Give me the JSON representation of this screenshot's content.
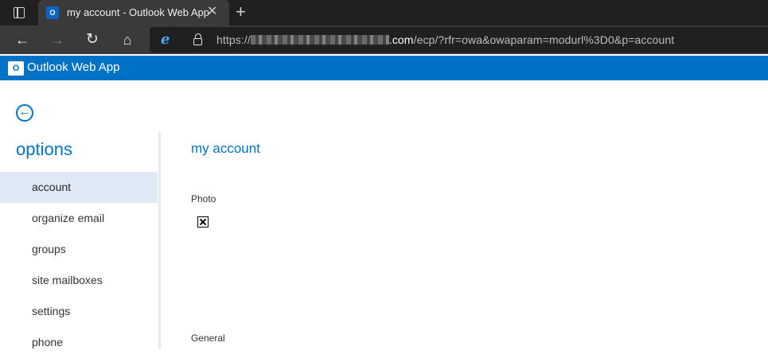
{
  "browser": {
    "tab_title": "my account - Outlook Web App",
    "tab_favicon": "O",
    "tab_close": "✕",
    "new_tab": "+",
    "url_prefix": "https://",
    "url_host": ".com",
    "url_path": "/ecp/?rfr=owa&owaparam=modurl%3D0&p=account"
  },
  "app": {
    "logo_text": "O",
    "title": "Outlook Web App"
  },
  "sidebar": {
    "title": "options",
    "items": [
      {
        "label": "account",
        "active": true
      },
      {
        "label": "organize email",
        "active": false
      },
      {
        "label": "groups",
        "active": false
      },
      {
        "label": "site mailboxes",
        "active": false
      },
      {
        "label": "settings",
        "active": false
      },
      {
        "label": "phone",
        "active": false
      }
    ]
  },
  "main": {
    "title": "my account",
    "photo_label": "Photo",
    "general_label": "General"
  },
  "colors": {
    "accent": "#0072c6",
    "selected_bg": "#dfe9f5"
  }
}
